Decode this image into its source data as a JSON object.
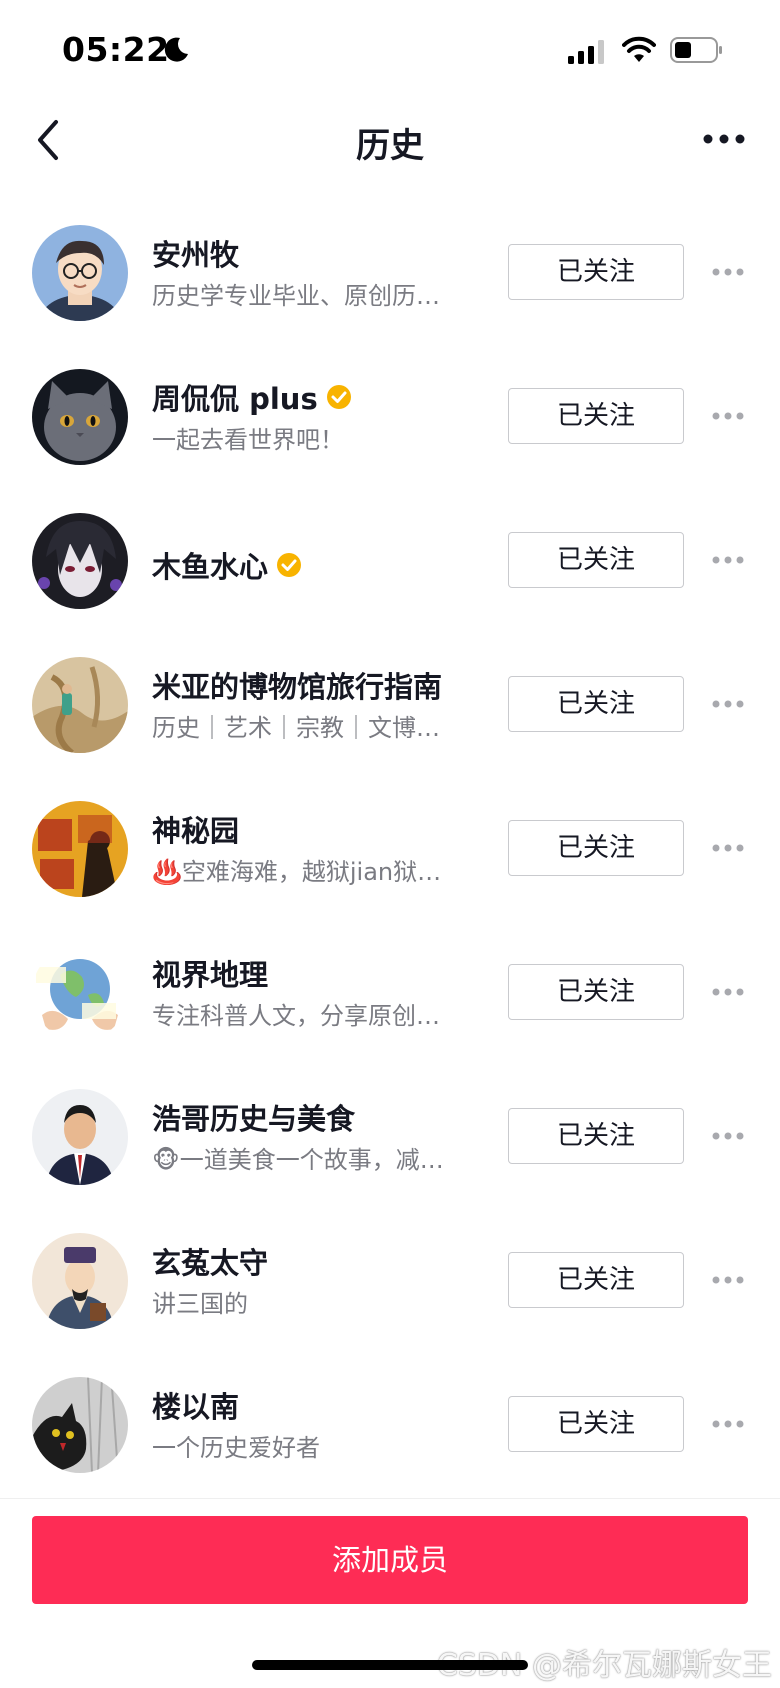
{
  "status_bar": {
    "time": "05:22",
    "icons": [
      "moon-icon",
      "signal-icon",
      "wifi-icon",
      "battery-icon"
    ]
  },
  "nav": {
    "title": "历史",
    "back_icon": "chevron-left-icon",
    "more_icon": "more-horizontal-icon"
  },
  "members": [
    {
      "name": "安州牧",
      "bio": "历史学专业毕业、原创历…",
      "verified": false,
      "button": "已关注"
    },
    {
      "name": "周侃侃 plus",
      "bio": "一起去看世界吧！",
      "verified": true,
      "button": "已关注"
    },
    {
      "name": "木鱼水心",
      "bio": "",
      "verified": true,
      "button": "已关注"
    },
    {
      "name": "米亚的博物馆旅行指南",
      "bio": "历史｜艺术｜宗教｜文博…",
      "verified": false,
      "button": "已关注"
    },
    {
      "name": "神秘园",
      "bio": "♨️空难海难，越狱jian狱…",
      "verified": false,
      "button": "已关注"
    },
    {
      "name": "视界地理",
      "bio": "专注科普人文，分享原创…",
      "verified": false,
      "button": "已关注"
    },
    {
      "name": "浩哥历史与美食",
      "bio": "🐵一道美食一个故事，减…",
      "verified": false,
      "button": "已关注"
    },
    {
      "name": "玄菟太守",
      "bio": "讲三国的",
      "verified": false,
      "button": "已关注"
    },
    {
      "name": "楼以南",
      "bio": "一个历史爱好者",
      "verified": false,
      "button": "已关注"
    }
  ],
  "footer": {
    "add_button": "添加成员",
    "watermark": "CSDN @希尔瓦娜斯女王"
  },
  "colors": {
    "accent": "#fe2c55",
    "verified": "#f8b300",
    "text_primary": "#161823",
    "text_secondary": "#7a7b82"
  }
}
